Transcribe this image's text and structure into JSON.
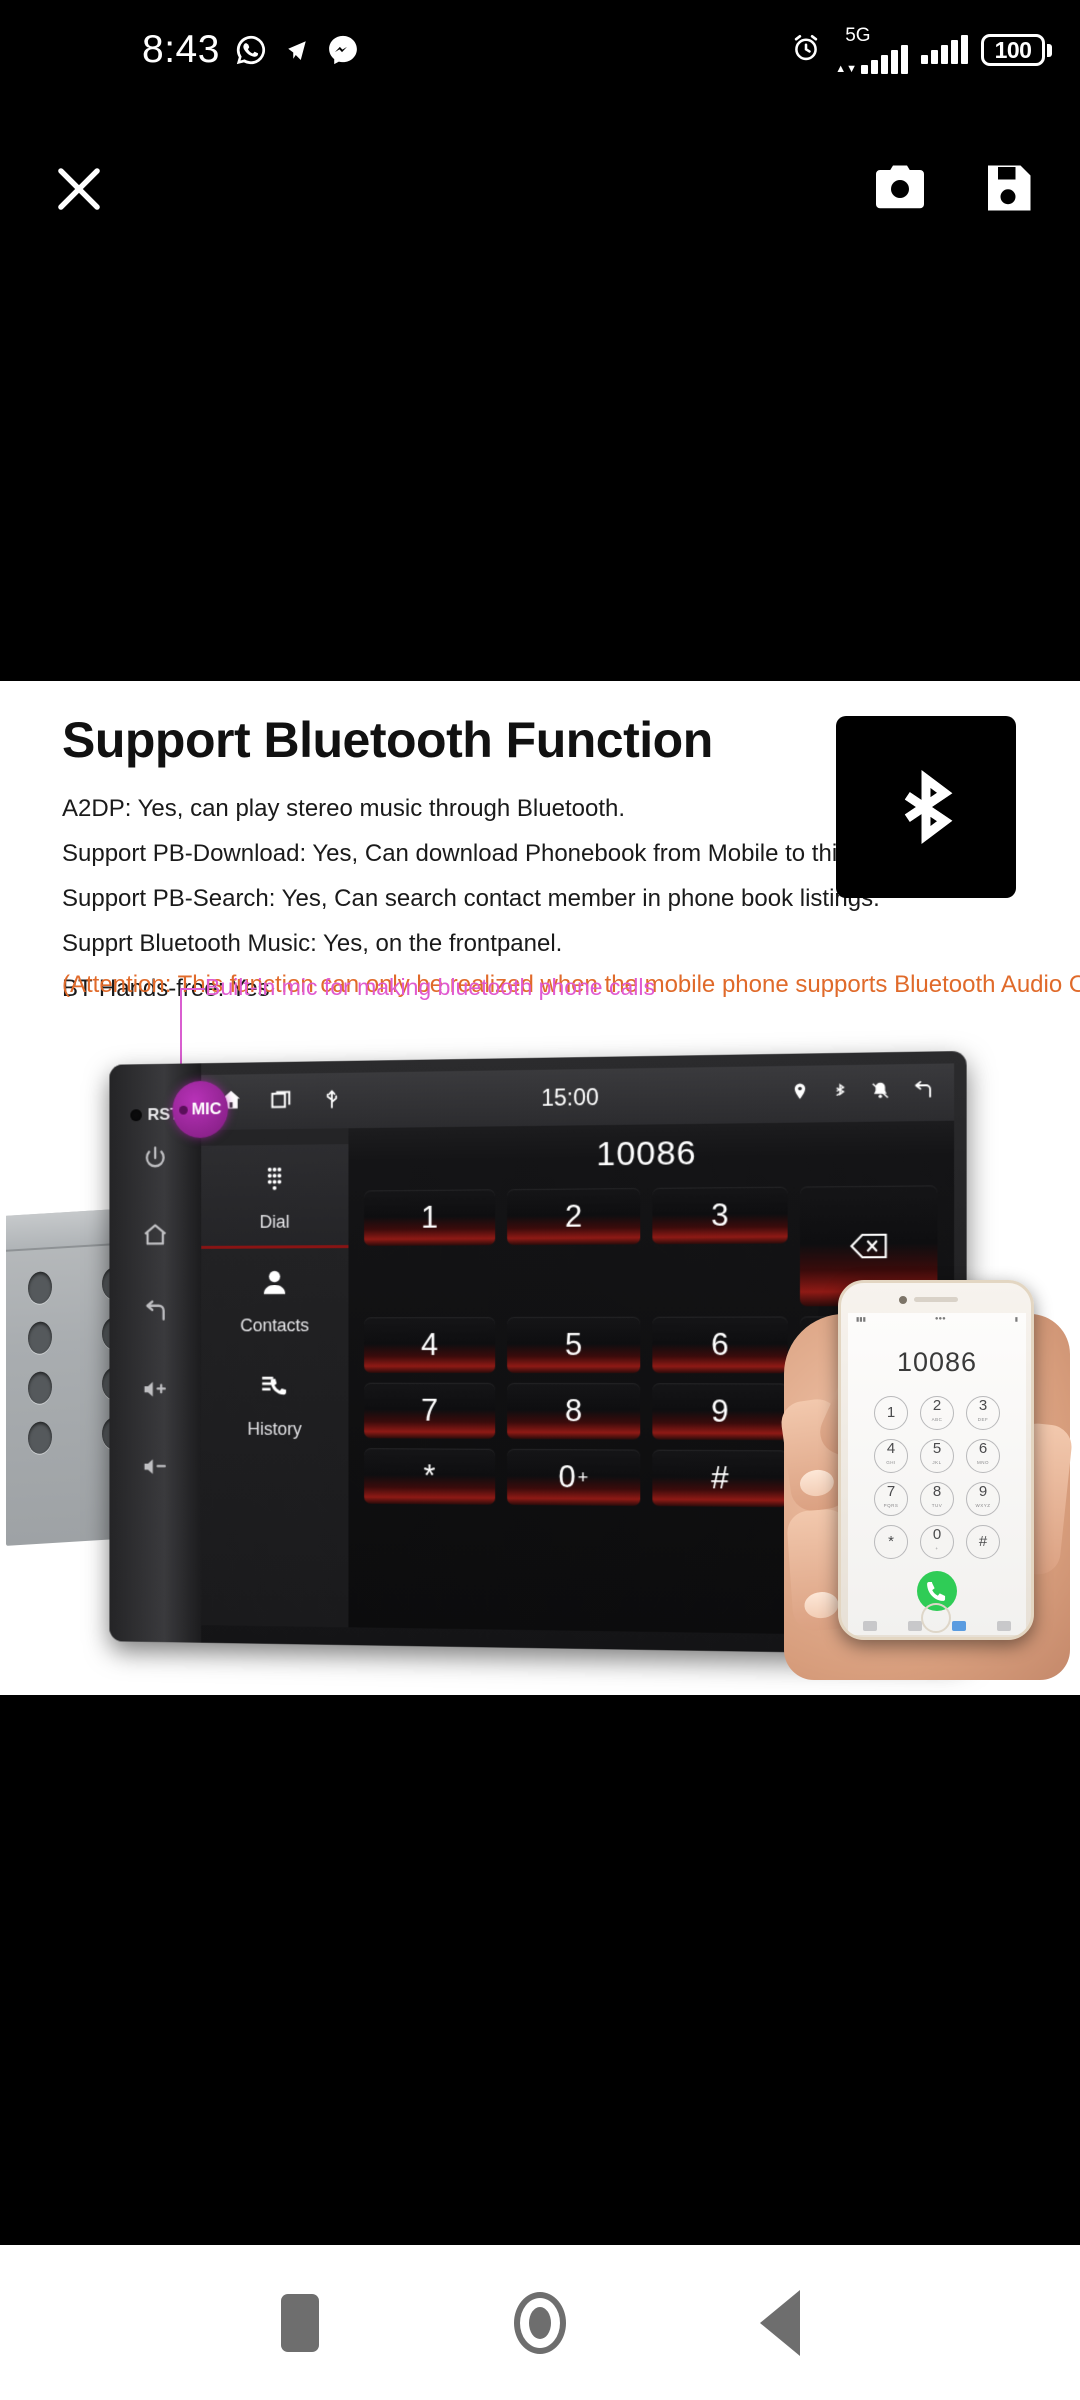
{
  "status_bar": {
    "time": "8:43",
    "left_icons": [
      "whatsapp-icon",
      "telegram-icon",
      "messenger-icon"
    ],
    "alarm_icon": "alarm-clock-icon",
    "network_label": "5G",
    "signal_icons": [
      "signal-bars-5g-icon",
      "signal-bars-icon"
    ],
    "battery_level": "100"
  },
  "toolbar": {
    "close_label": "close-icon",
    "camera_label": "camera-icon",
    "save_label": "save-icon"
  },
  "panel": {
    "headline": "Support Bluetooth Function",
    "specs": [
      "A2DP: Yes, can play stereo music through Bluetooth.",
      "Support PB-Download: Yes, Can download Phonebook from Mobile to this unit.",
      "Support PB-Search: Yes, Can search contact member in phone book listings.",
      "Supprt Bluetooth Music: Yes, on the frontpanel.",
      "BT Hands-free: Yes"
    ],
    "attention": "(Attention: This function can only be realized when the mobile phone supports Bluetooth Audio Output.)",
    "attention_color": "#e06a2a",
    "bluetooth_badge_icon": "bluetooth-icon"
  },
  "annotation": {
    "text": "Built-in mic for making bluetooth phone calls",
    "color": "#e05ad0"
  },
  "stereo": {
    "mic_badge": "MIC",
    "reset_label": "RST",
    "side_buttons": [
      "power-icon",
      "home-icon",
      "back-icon",
      "volume-up-icon",
      "volume-down-icon"
    ],
    "lcd": {
      "top_left_icons": [
        "home-icon",
        "recents-icon",
        "usb-icon"
      ],
      "clock": "15:00",
      "top_right_icons": [
        "location-icon",
        "bluetooth-icon",
        "mute-icon",
        "back-icon"
      ],
      "tabs": [
        {
          "label": "Dial",
          "icon": "keypad-icon",
          "active": true
        },
        {
          "label": "Contacts",
          "icon": "person-icon",
          "active": false
        },
        {
          "label": "History",
          "icon": "call-history-icon",
          "active": false
        }
      ],
      "number": "10086",
      "keys": [
        "1",
        "2",
        "3",
        "4",
        "5",
        "6",
        "7",
        "8",
        "9",
        "*",
        "0",
        "#"
      ],
      "zero_plus": "+",
      "backspace_icon": "backspace-icon",
      "call_icon": "call-icon",
      "call_color": "#19d21a"
    }
  },
  "hand_phone": {
    "number": "10086",
    "keys": [
      {
        "digit": "1",
        "letters": ""
      },
      {
        "digit": "2",
        "letters": "ABC"
      },
      {
        "digit": "3",
        "letters": "DEF"
      },
      {
        "digit": "4",
        "letters": "GHI"
      },
      {
        "digit": "5",
        "letters": "JKL"
      },
      {
        "digit": "6",
        "letters": "MNO"
      },
      {
        "digit": "7",
        "letters": "PQRS"
      },
      {
        "digit": "8",
        "letters": "TUV"
      },
      {
        "digit": "9",
        "letters": "WXYZ"
      },
      {
        "digit": "*",
        "letters": ""
      },
      {
        "digit": "0",
        "letters": "+"
      },
      {
        "digit": "#",
        "letters": ""
      }
    ],
    "call_icon": "call-icon"
  },
  "nav_bar": {
    "recents_label": "recents-icon",
    "home_label": "home-icon",
    "back_label": "back-icon"
  }
}
